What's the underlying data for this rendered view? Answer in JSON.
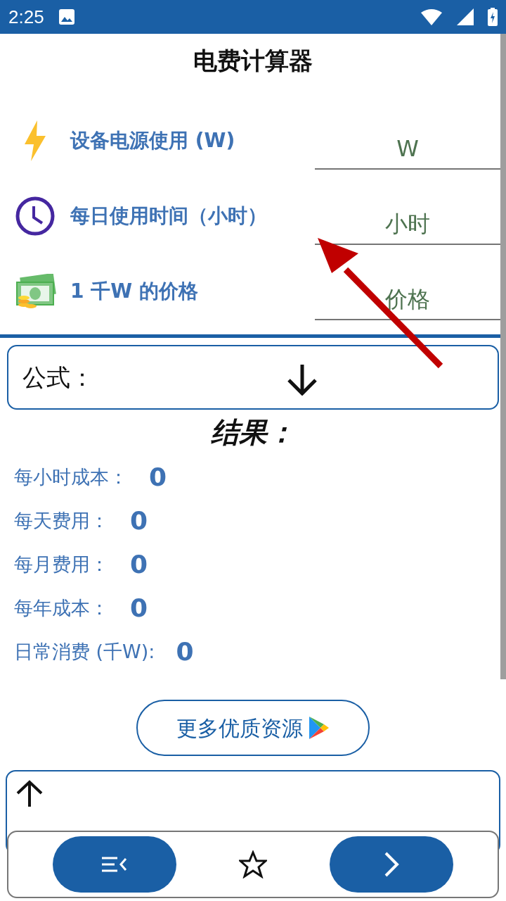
{
  "status_bar": {
    "time": "2:25"
  },
  "title": "电费计算器",
  "inputs": [
    {
      "kind": "bolt",
      "label": "设备电源使用 (W)",
      "placeholder": "W"
    },
    {
      "kind": "clock",
      "label": "每日使用时间（小时）",
      "placeholder": "小时"
    },
    {
      "kind": "money",
      "label": "1 千W 的价格",
      "placeholder": "价格"
    }
  ],
  "formula": {
    "label": "公式："
  },
  "results": {
    "title": "结果：",
    "rows": [
      {
        "label": "每小时成本：",
        "value": "0"
      },
      {
        "label": "每天费用：",
        "value": "0"
      },
      {
        "label": "每月费用：",
        "value": "0"
      },
      {
        "label": "每年成本：",
        "value": "0"
      },
      {
        "label": "日常消费 (千W):",
        "value": "0"
      }
    ]
  },
  "more_button": {
    "label": "更多优质资源"
  }
}
